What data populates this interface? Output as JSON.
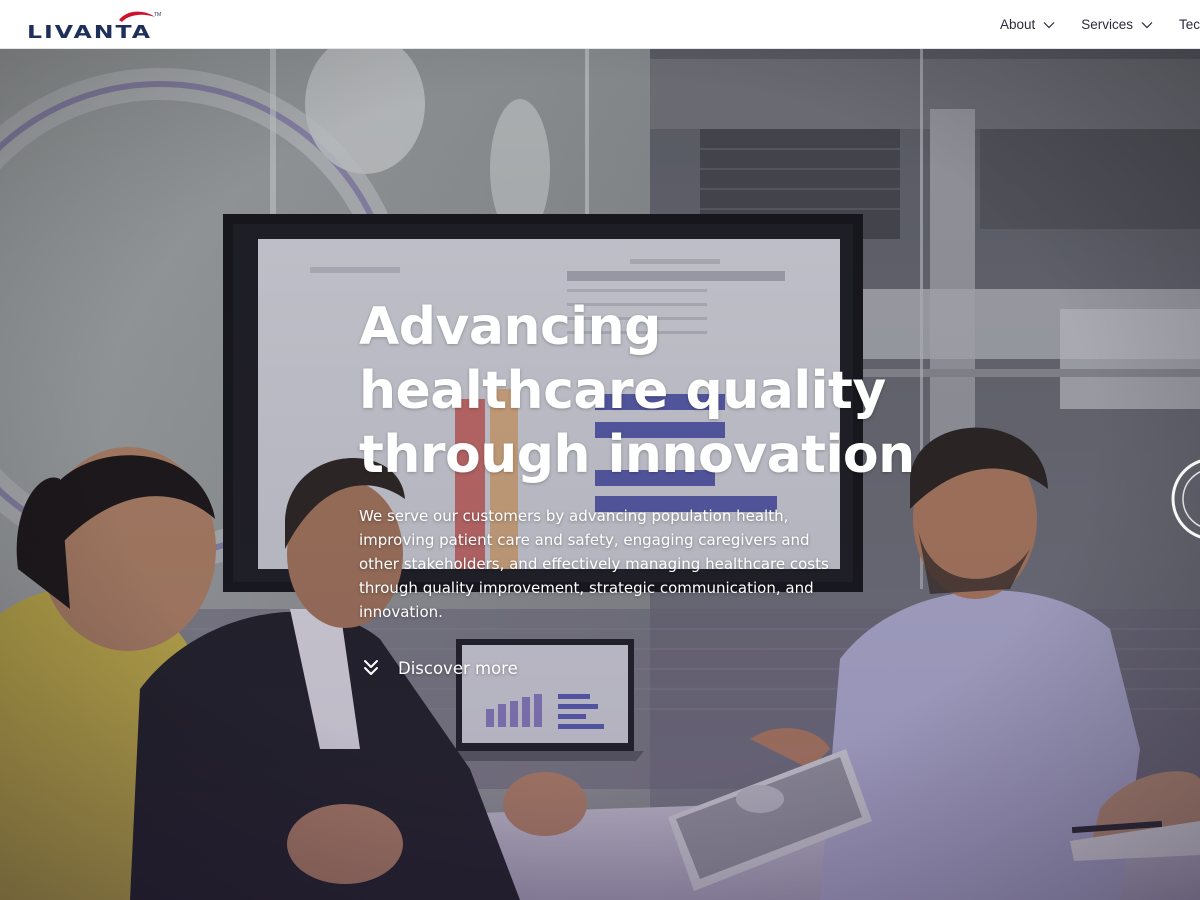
{
  "brand": {
    "name": "LIVANTA",
    "trademark": "TM",
    "color": "#1e2f5c",
    "accent_color": "#d0112b"
  },
  "nav": {
    "items": [
      {
        "label": "About",
        "icon": "chevron-down-icon"
      },
      {
        "label": "Services",
        "icon": "chevron-down-icon"
      },
      {
        "label": "Tech"
      }
    ]
  },
  "hero": {
    "title": "Advancing\nhealthcare quality\nthrough innovation",
    "description": "We serve our customers by advancing population health, improving patient care and safety, engaging caregivers and other stakeholders, and effectively managing healthcare costs through quality improvement, strategic communication, and innovation.",
    "cta": {
      "label": "Discover more",
      "icon": "double-chevron-down-icon"
    },
    "background": "office-meeting-photo"
  }
}
